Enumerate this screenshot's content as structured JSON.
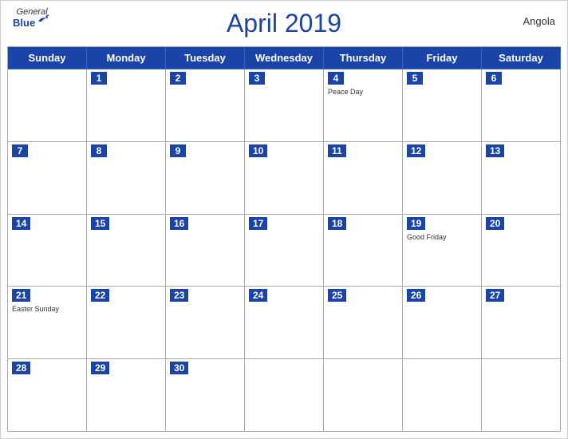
{
  "header": {
    "title": "April 2019",
    "country": "Angola",
    "logo": {
      "general": "General",
      "blue": "Blue"
    }
  },
  "dayHeaders": [
    "Sunday",
    "Monday",
    "Tuesday",
    "Wednesday",
    "Thursday",
    "Friday",
    "Saturday"
  ],
  "weeks": [
    [
      {
        "date": null,
        "holiday": null
      },
      {
        "date": 1,
        "holiday": null
      },
      {
        "date": 2,
        "holiday": null
      },
      {
        "date": 3,
        "holiday": null
      },
      {
        "date": 4,
        "holiday": "Peace Day"
      },
      {
        "date": 5,
        "holiday": null
      },
      {
        "date": 6,
        "holiday": null
      }
    ],
    [
      {
        "date": 7,
        "holiday": null
      },
      {
        "date": 8,
        "holiday": null
      },
      {
        "date": 9,
        "holiday": null
      },
      {
        "date": 10,
        "holiday": null
      },
      {
        "date": 11,
        "holiday": null
      },
      {
        "date": 12,
        "holiday": null
      },
      {
        "date": 13,
        "holiday": null
      }
    ],
    [
      {
        "date": 14,
        "holiday": null
      },
      {
        "date": 15,
        "holiday": null
      },
      {
        "date": 16,
        "holiday": null
      },
      {
        "date": 17,
        "holiday": null
      },
      {
        "date": 18,
        "holiday": null
      },
      {
        "date": 19,
        "holiday": "Good Friday"
      },
      {
        "date": 20,
        "holiday": null
      }
    ],
    [
      {
        "date": 21,
        "holiday": "Easter Sunday"
      },
      {
        "date": 22,
        "holiday": null
      },
      {
        "date": 23,
        "holiday": null
      },
      {
        "date": 24,
        "holiday": null
      },
      {
        "date": 25,
        "holiday": null
      },
      {
        "date": 26,
        "holiday": null
      },
      {
        "date": 27,
        "holiday": null
      }
    ],
    [
      {
        "date": 28,
        "holiday": null
      },
      {
        "date": 29,
        "holiday": null
      },
      {
        "date": 30,
        "holiday": null
      },
      {
        "date": null,
        "holiday": null
      },
      {
        "date": null,
        "holiday": null
      },
      {
        "date": null,
        "holiday": null
      },
      {
        "date": null,
        "holiday": null
      }
    ]
  ],
  "colors": {
    "headerBlue": "#1a44a8",
    "white": "#ffffff",
    "borderGray": "#aaaaaa",
    "textDark": "#333333"
  }
}
